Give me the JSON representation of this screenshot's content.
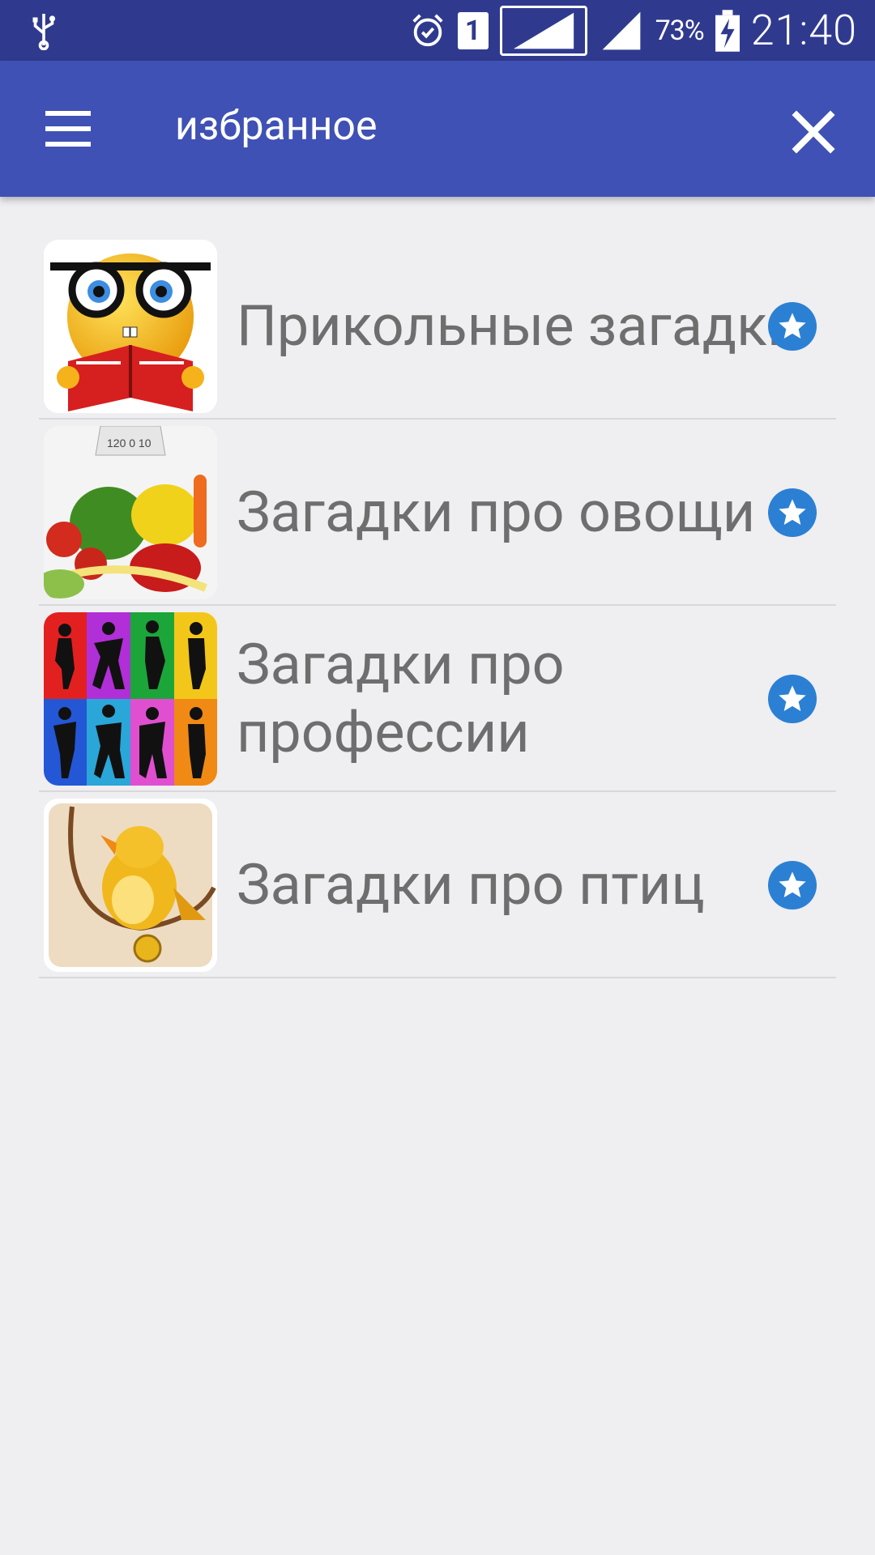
{
  "status_bar": {
    "usb_icon": "usb-icon",
    "alarm_icon": "alarm-icon",
    "sim_label": "1",
    "battery_percent": "73%",
    "time": "21:40"
  },
  "app_bar": {
    "menu_icon": "hamburger-menu-icon",
    "title": "избранное",
    "close_icon": "close-icon",
    "color": "#3f51b5"
  },
  "favorites": [
    {
      "title": "Прикольные загадки",
      "image": "emoji-reading-book"
    },
    {
      "title": "Загадки про овощи",
      "image": "vegetables-with-scale"
    },
    {
      "title": "Загадки про профессии",
      "image": "silhouettes-colorful"
    },
    {
      "title": "Загадки про птиц",
      "image": "yellow-bird-on-ring"
    }
  ],
  "star_color": "#2b80d4"
}
